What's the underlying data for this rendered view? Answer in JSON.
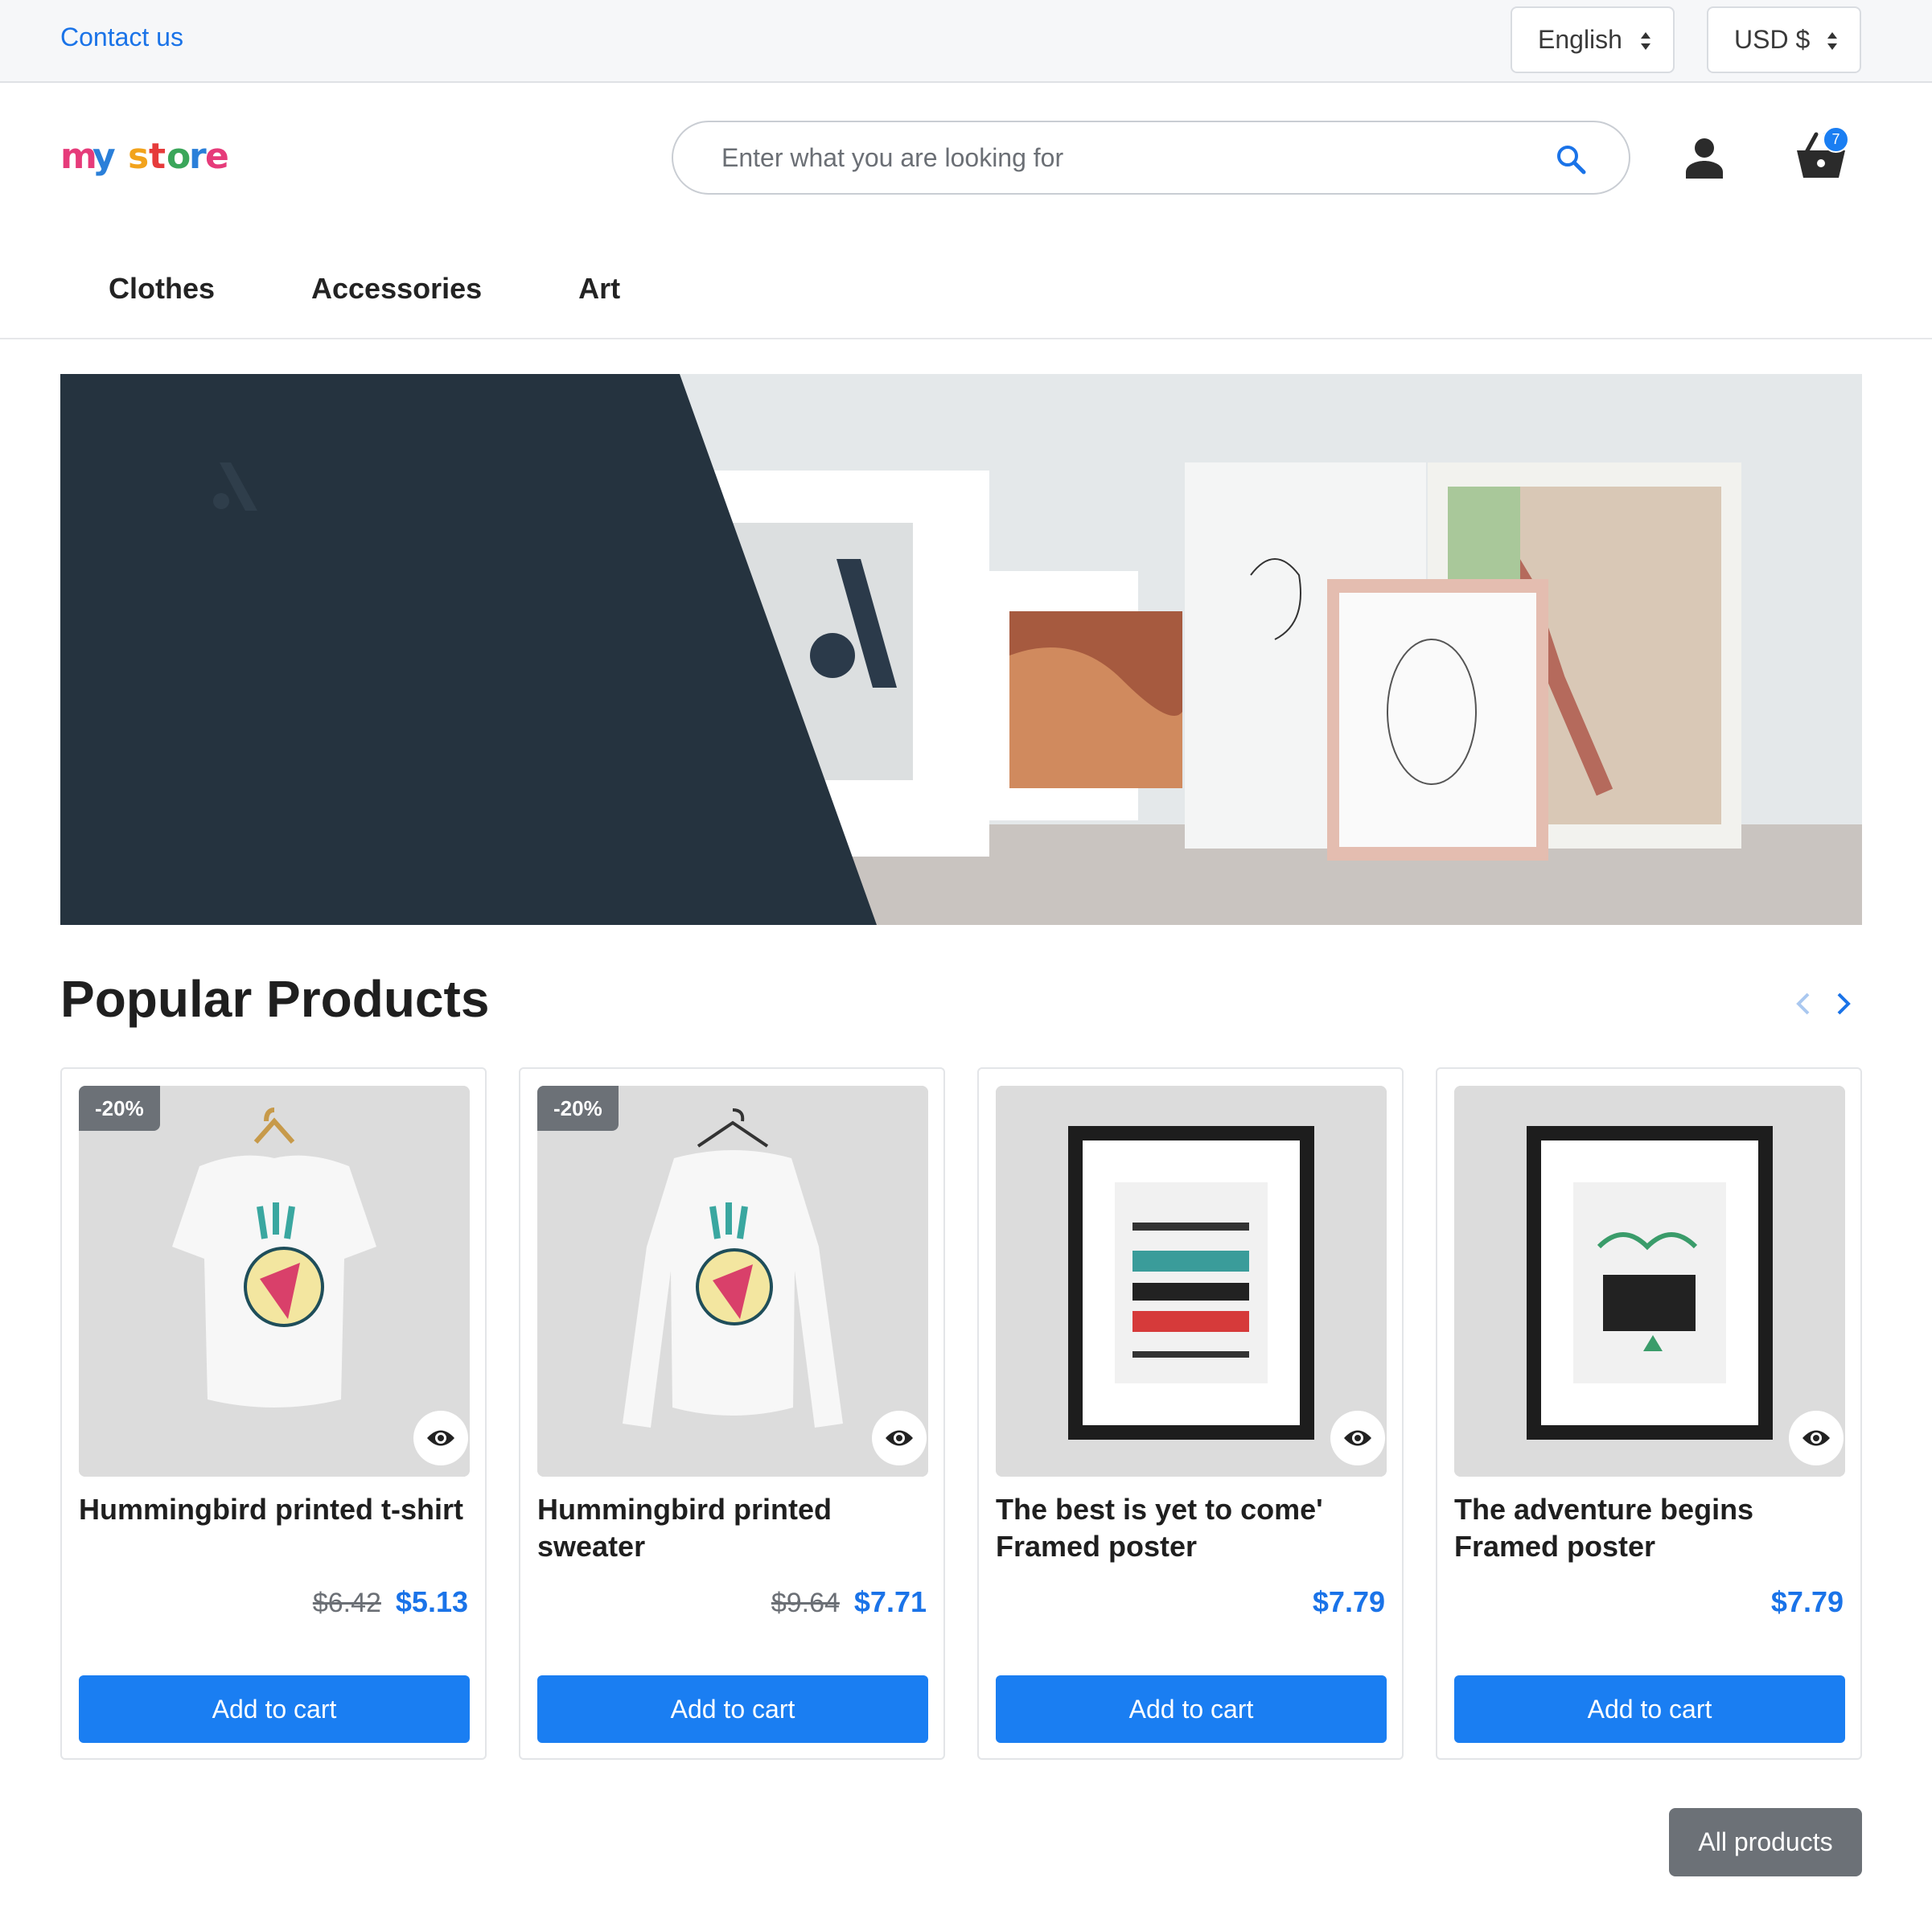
{
  "topbar": {
    "contact_label": "Contact us",
    "language": "English",
    "currency": "USD $"
  },
  "header": {
    "logo_text": "my store",
    "search_placeholder": "Enter what you are looking for",
    "cart_count": "7"
  },
  "nav": {
    "items": [
      "Clothes",
      "Accessories",
      "Art"
    ]
  },
  "section": {
    "title": "Popular Products",
    "all_products_label": "All products"
  },
  "products": [
    {
      "name": "Hummingbird printed t-shirt",
      "discount": "-20%",
      "old_price": "$6.42",
      "price": "$5.13",
      "button": "Add to cart"
    },
    {
      "name": "Hummingbird printed sweater",
      "discount": "-20%",
      "old_price": "$9.64",
      "price": "$7.71",
      "button": "Add to cart"
    },
    {
      "name": "The best is yet to come' Framed poster",
      "discount": "",
      "old_price": "",
      "price": "$7.79",
      "button": "Add to cart"
    },
    {
      "name": "The adventure begins Framed poster",
      "discount": "",
      "old_price": "",
      "price": "$7.79",
      "button": "Add to cart"
    }
  ],
  "colors": {
    "accent": "#1a7ef2",
    "link": "#1a73e8",
    "badge": "#6c7177",
    "banner_dark": "#25333f"
  },
  "icons": [
    "search-icon",
    "user-icon",
    "cart-icon",
    "eye-icon",
    "chevron-left-icon",
    "chevron-right-icon"
  ]
}
